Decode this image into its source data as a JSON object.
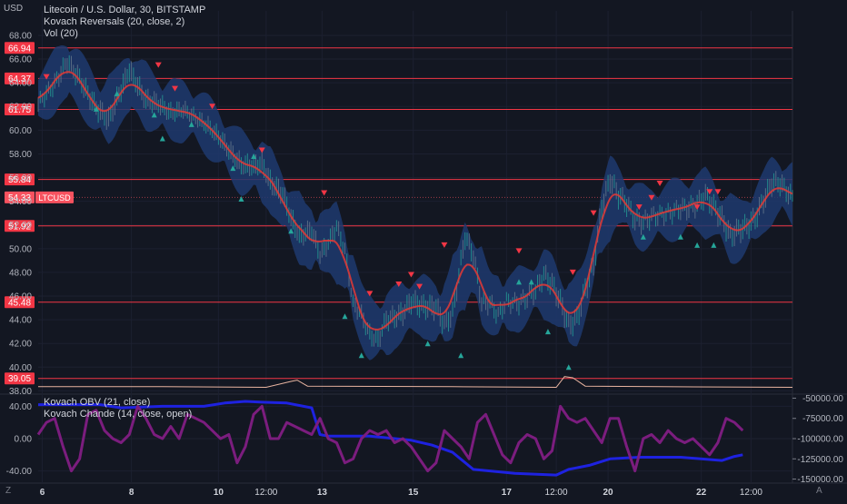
{
  "header": {
    "currency": "USD",
    "title": "Litecoin / U.S. Dollar, 30, BITSTAMP",
    "indicator1": "Kovach Reversals (20, close, 2)",
    "indicator2": "Vol (20)"
  },
  "lower_pane": {
    "indicator1": "Kovach OBV (21, close)",
    "indicator2": "Kovach Chande (14, close, open)"
  },
  "bottom_bar": {
    "left_icon": "Z",
    "right_icon": "A"
  },
  "colors": {
    "background": "#131722",
    "level_line": "#f23645",
    "price_band": "#1e3a6e",
    "ma_line": "#e53935",
    "up_marker": "#26a69a",
    "down_marker": "#f23645",
    "obv_line": "#1e22e0",
    "chande_line": "#7b1d7e",
    "volume_line": "#e8b4a0"
  },
  "chart_data": [
    {
      "type": "line",
      "title": "Litecoin / U.S. Dollar, 30, BITSTAMP",
      "symbol": "LTCUSD",
      "y_axis_label": "USD",
      "ylim": [
        37.8,
        69.3
      ],
      "y_ticks": [
        38.0,
        40.0,
        42.0,
        44.0,
        46.0,
        48.0,
        50.0,
        52.0,
        54.0,
        56.0,
        58.0,
        60.0,
        62.0,
        64.0,
        66.0,
        68.0
      ],
      "x_ticks": [
        "6",
        "8",
        "10",
        "12:00",
        "13",
        "15",
        "17",
        "12:00",
        "20",
        "22",
        "12:00"
      ],
      "x_tick_positions": [
        2,
        45,
        87,
        110,
        137,
        181,
        226,
        250,
        275,
        320,
        344
      ],
      "xlim": [
        0,
        364
      ],
      "horizontal_levels": [
        66.94,
        64.37,
        61.75,
        55.84,
        51.92,
        45.48,
        39.05
      ],
      "last_price": {
        "value": "54.33",
        "label": "LTCUSD"
      },
      "series": [
        {
          "style": "close-with-band",
          "x": [
            0,
            8,
            14,
            20,
            24,
            28,
            34,
            38,
            44,
            48,
            52,
            58,
            64,
            70,
            76,
            82,
            88,
            92,
            98,
            104,
            108,
            112,
            118,
            122,
            126,
            132,
            136,
            140,
            144,
            148,
            152,
            156,
            160,
            164,
            168,
            172,
            176,
            180,
            186,
            192,
            196,
            200,
            206,
            210,
            214,
            218,
            222,
            226,
            232,
            236,
            240,
            244,
            248,
            252,
            256,
            260,
            264,
            268,
            272,
            276,
            280,
            284,
            288,
            292,
            296,
            300,
            306,
            310,
            314,
            318,
            322,
            326,
            330,
            334,
            338,
            342,
            346,
            350,
            354,
            358,
            364
          ],
          "values": [
            62.4,
            64.0,
            65.8,
            64.3,
            63.0,
            61.8,
            60.8,
            62.5,
            65.0,
            63.7,
            62.5,
            62.2,
            61.5,
            61.8,
            61.2,
            60.4,
            59.3,
            58.3,
            57.0,
            56.9,
            57.1,
            55.5,
            54.5,
            52.5,
            51.0,
            51.5,
            49.5,
            50.5,
            52.0,
            50.0,
            45.5,
            44.5,
            42.8,
            42.3,
            44.0,
            44.2,
            44.5,
            45.5,
            45.0,
            45.0,
            43.5,
            44.5,
            51.0,
            49.5,
            45.5,
            45.5,
            44.5,
            45.7,
            45.5,
            46.0,
            46.5,
            47.8,
            47.0,
            45.5,
            43.5,
            44.0,
            46.5,
            48.5,
            53.5,
            55.8,
            54.5,
            53.8,
            52.5,
            52.3,
            52.8,
            53.0,
            53.2,
            53.5,
            53.5,
            53.8,
            54.5,
            53.5,
            52.5,
            51.0,
            51.5,
            51.8,
            52.5,
            54.0,
            55.5,
            55.5,
            54.3
          ]
        },
        {
          "name": "Vol (20)",
          "x": [
            0,
            60,
            110,
            122,
            125,
            130,
            200,
            250,
            254,
            258,
            264,
            300,
            364
          ],
          "values": [
            38.35,
            38.35,
            38.3,
            38.8,
            38.9,
            38.4,
            38.35,
            38.3,
            39.2,
            39.1,
            38.4,
            38.35,
            38.3
          ]
        }
      ],
      "reversal_markers": {
        "down": [
          [
            4,
            64.5
          ],
          [
            58,
            65.5
          ],
          [
            66,
            63.5
          ],
          [
            84,
            62.0
          ],
          [
            108,
            58.3
          ],
          [
            138,
            54.7
          ],
          [
            160,
            46.2
          ],
          [
            174,
            47.0
          ],
          [
            180,
            47.8
          ],
          [
            184,
            46.8
          ],
          [
            196,
            50.3
          ],
          [
            232,
            49.8
          ],
          [
            258,
            48.0
          ],
          [
            268,
            53.0
          ],
          [
            290,
            53.5
          ],
          [
            296,
            54.3
          ],
          [
            300,
            55.5
          ],
          [
            318,
            53.5
          ],
          [
            324,
            54.8
          ],
          [
            328,
            54.8
          ]
        ],
        "up": [
          [
            28,
            61.8
          ],
          [
            38,
            63.1
          ],
          [
            56,
            61.3
          ],
          [
            60,
            59.3
          ],
          [
            74,
            60.5
          ],
          [
            94,
            56.8
          ],
          [
            98,
            54.2
          ],
          [
            104,
            57.8
          ],
          [
            122,
            51.5
          ],
          [
            148,
            44.3
          ],
          [
            156,
            41.0
          ],
          [
            188,
            42.0
          ],
          [
            204,
            41.0
          ],
          [
            232,
            47.2
          ],
          [
            238,
            47.2
          ],
          [
            246,
            43.0
          ],
          [
            256,
            40.0
          ],
          [
            292,
            51.0
          ],
          [
            310,
            51.0
          ],
          [
            318,
            50.3
          ],
          [
            326,
            50.3
          ]
        ]
      }
    },
    {
      "type": "line",
      "title": "Kovach OBV (21, close) / Kovach Chande (14, close, open)",
      "xlim": [
        0,
        364
      ],
      "left_axis": {
        "ylim": [
          -55,
          55
        ],
        "ticks": [
          "40.00",
          "0.00",
          "-40.00"
        ],
        "tick_values": [
          40,
          0,
          -40
        ]
      },
      "right_axis": {
        "ylim": [
          -155000,
          -45000
        ],
        "ticks": [
          "-50000.00",
          "-75000.00",
          "-100000.00",
          "-125000.00",
          "-150000.00"
        ],
        "tick_values": [
          -50000,
          -75000,
          -100000,
          -125000,
          -150000
        ]
      },
      "series": [
        {
          "name": "Kovach OBV (21, close)",
          "axis": "right",
          "x": [
            0,
            30,
            40,
            60,
            80,
            90,
            100,
            108,
            120,
            132,
            136,
            140,
            160,
            180,
            190,
            200,
            210,
            230,
            250,
            256,
            266,
            276,
            290,
            310,
            330,
            336,
            340
          ],
          "values": [
            -58000,
            -58000,
            -62000,
            -60000,
            -60000,
            -56000,
            -54000,
            -55000,
            -56000,
            -62000,
            -95000,
            -97000,
            -97000,
            -102000,
            -108000,
            -117000,
            -138000,
            -143000,
            -145000,
            -138000,
            -133000,
            -125000,
            -123000,
            -123000,
            -127000,
            -122000,
            -120000
          ]
        },
        {
          "name": "Kovach Chande (14, close, open)",
          "axis": "left",
          "x": [
            0,
            4,
            8,
            12,
            16,
            20,
            24,
            28,
            32,
            36,
            40,
            44,
            48,
            52,
            56,
            60,
            64,
            68,
            72,
            76,
            80,
            84,
            88,
            92,
            96,
            100,
            104,
            108,
            112,
            116,
            120,
            124,
            128,
            132,
            136,
            140,
            144,
            148,
            152,
            156,
            160,
            164,
            168,
            172,
            176,
            180,
            184,
            188,
            192,
            196,
            200,
            204,
            208,
            212,
            216,
            220,
            224,
            228,
            232,
            236,
            240,
            244,
            248,
            252,
            256,
            260,
            264,
            268,
            272,
            276,
            280,
            284,
            288,
            292,
            296,
            300,
            304,
            308,
            312,
            316,
            320,
            324,
            328,
            332,
            336,
            340
          ],
          "values": [
            5,
            20,
            25,
            -10,
            -40,
            -25,
            30,
            35,
            10,
            0,
            -5,
            5,
            40,
            25,
            5,
            0,
            15,
            0,
            30,
            25,
            20,
            10,
            0,
            5,
            -30,
            -10,
            30,
            40,
            0,
            0,
            20,
            15,
            10,
            5,
            25,
            0,
            -5,
            -30,
            -25,
            0,
            10,
            5,
            10,
            -5,
            0,
            -10,
            -25,
            -40,
            -30,
            10,
            0,
            -10,
            -25,
            20,
            30,
            5,
            -20,
            -30,
            -5,
            5,
            0,
            -25,
            -15,
            40,
            25,
            20,
            25,
            10,
            -5,
            25,
            25,
            -10,
            -40,
            0,
            5,
            -5,
            10,
            0,
            -5,
            0,
            -10,
            -20,
            -5,
            25,
            20,
            10
          ]
        }
      ]
    }
  ]
}
